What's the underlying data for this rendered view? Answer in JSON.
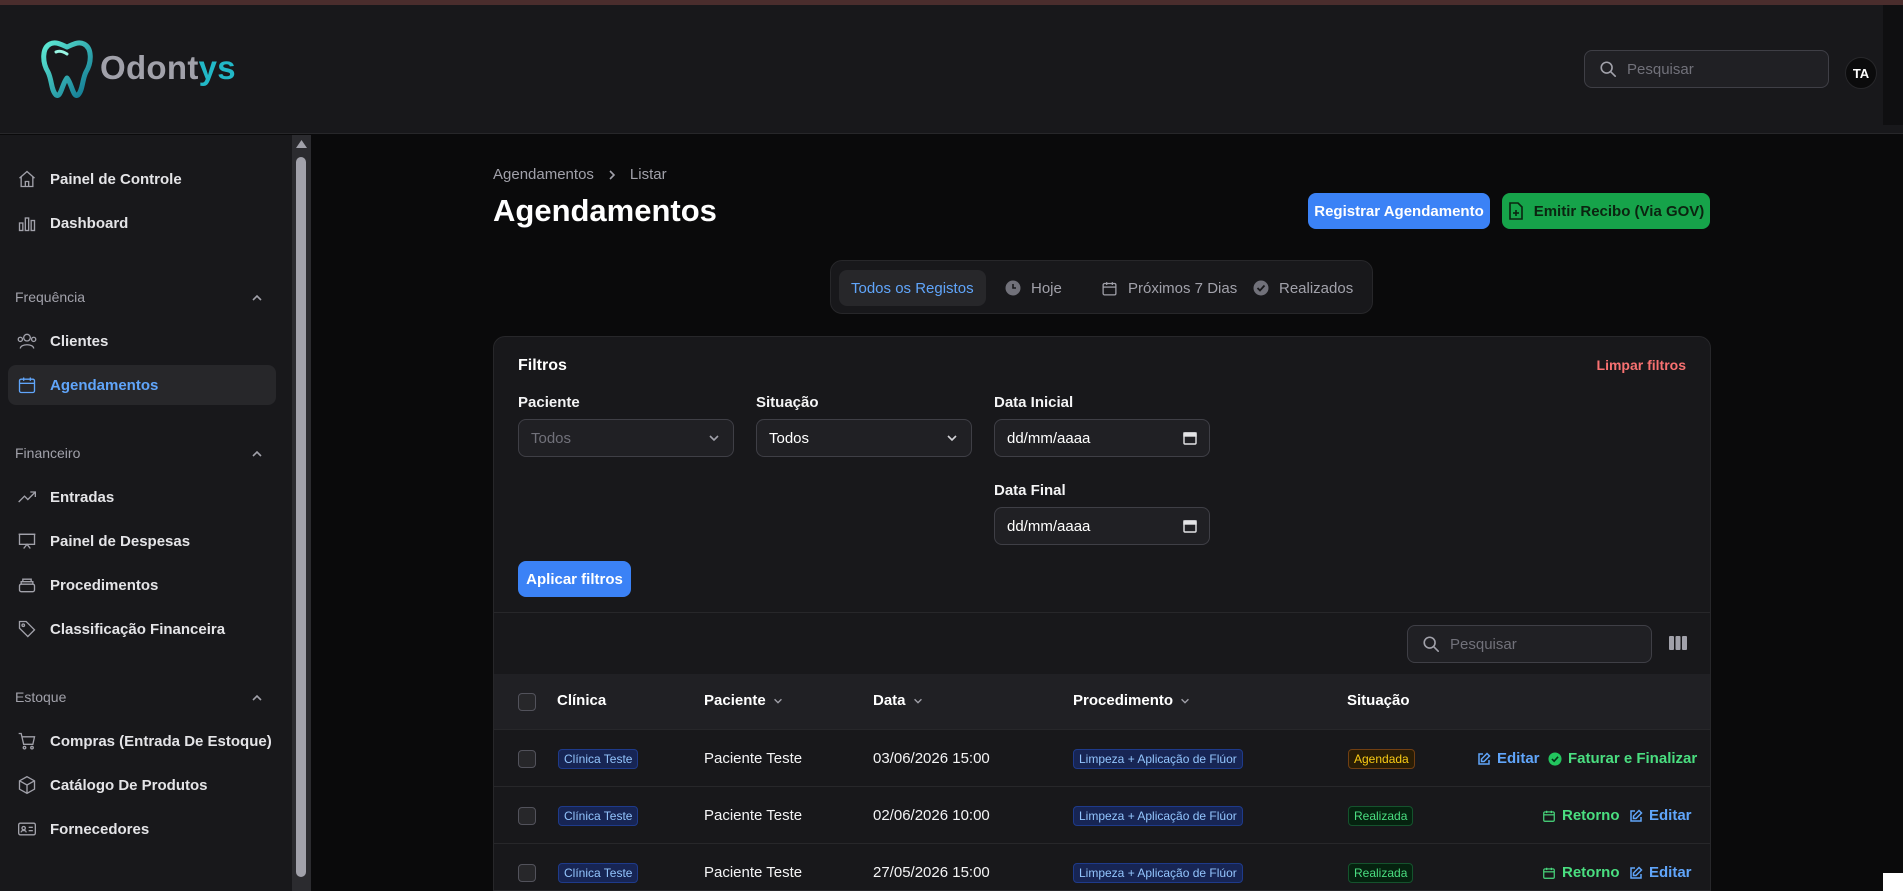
{
  "app": {
    "logo_a": "Odont",
    "logo_b": "ys"
  },
  "header": {
    "search_placeholder": "Pesquisar",
    "avatar": "TA"
  },
  "sidebar": {
    "items_top": [
      {
        "label": "Painel de Controle",
        "icon": "home-icon"
      },
      {
        "label": "Dashboard",
        "icon": "bar-chart-icon"
      }
    ],
    "groups": [
      {
        "label": "Frequência",
        "items": [
          {
            "label": "Clientes",
            "icon": "users-icon"
          },
          {
            "label": "Agendamentos",
            "icon": "calendar-icon",
            "active": true
          }
        ]
      },
      {
        "label": "Financeiro",
        "items": [
          {
            "label": "Entradas",
            "icon": "trending-up-icon"
          },
          {
            "label": "Painel de Despesas",
            "icon": "presentation-icon"
          },
          {
            "label": "Procedimentos",
            "icon": "stack-icon"
          },
          {
            "label": "Classificação Financeira",
            "icon": "tag-icon"
          }
        ]
      },
      {
        "label": "Estoque",
        "items": [
          {
            "label": "Compras (Entrada De Estoque)",
            "icon": "cart-icon"
          },
          {
            "label": "Catálogo De Produtos",
            "icon": "cube-icon"
          },
          {
            "label": "Fornecedores",
            "icon": "id-card-icon"
          }
        ]
      }
    ]
  },
  "breadcrumb": {
    "root": "Agendamentos",
    "current": "Listar"
  },
  "page": {
    "title": "Agendamentos",
    "register_button": "Registrar Agendamento",
    "receipt_button": "Emitir Recibo (Via GOV)"
  },
  "tabs": [
    {
      "label": "Todos os Registos",
      "active": true
    },
    {
      "label": "Hoje",
      "icon": "clock-icon"
    },
    {
      "label": "Próximos 7 Dias",
      "icon": "calendar-icon"
    },
    {
      "label": "Realizados",
      "icon": "check-circle-icon"
    }
  ],
  "filters": {
    "title": "Filtros",
    "clear": "Limpar filtros",
    "patient_label": "Paciente",
    "patient_value": "Todos",
    "status_label": "Situação",
    "status_value": "Todos",
    "start_label": "Data Inicial",
    "start_value": "dd/mm/aaaa",
    "end_label": "Data Final",
    "end_value": "dd/mm/aaaa",
    "apply": "Aplicar filtros"
  },
  "table": {
    "search_placeholder": "Pesquisar",
    "columns": [
      "Clínica",
      "Paciente",
      "Data",
      "Procedimento",
      "Situação"
    ],
    "rows": [
      {
        "clinic": "Clínica Teste",
        "patient": "Paciente Teste",
        "date": "03/06/2026 15:00",
        "procedure": "Limpeza + Aplicação de Flúor",
        "status": "Agendada",
        "status_color": "#facc15",
        "actions": [
          "Editar",
          "Faturar e Finalizar"
        ]
      },
      {
        "clinic": "Clínica Teste",
        "patient": "Paciente Teste",
        "date": "02/06/2026 10:00",
        "procedure": "Limpeza + Aplicação de Flúor",
        "status": "Realizada",
        "status_color": "#4ade80",
        "actions": [
          "Retorno",
          "Editar"
        ]
      },
      {
        "clinic": "Clínica Teste",
        "patient": "Paciente Teste",
        "date": "27/05/2026 15:00",
        "procedure": "Limpeza + Aplicação de Flúor",
        "status": "Realizada",
        "status_color": "#4ade80",
        "actions": [
          "Retorno",
          "Editar"
        ]
      }
    ]
  }
}
